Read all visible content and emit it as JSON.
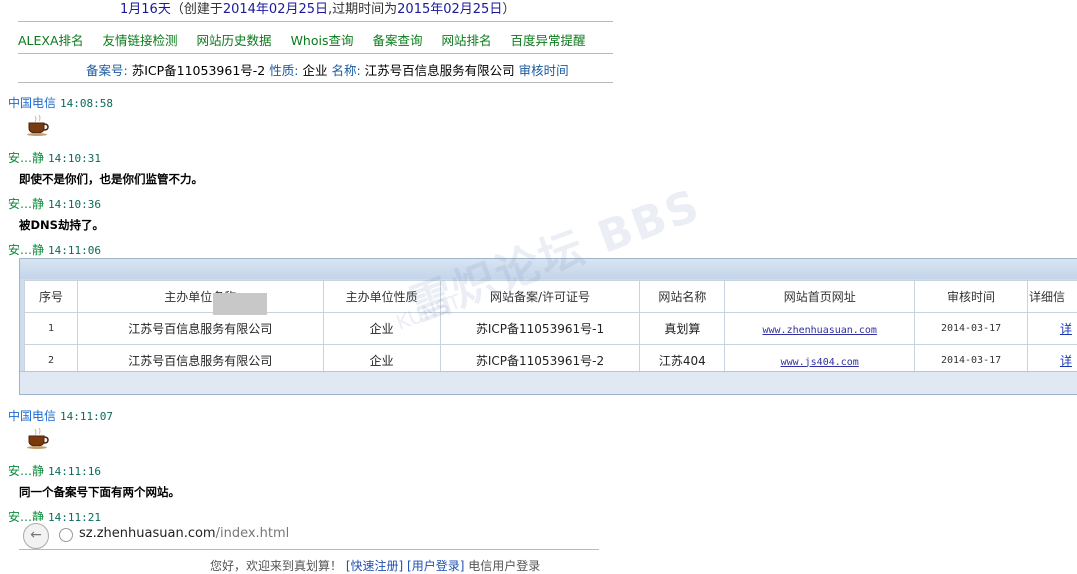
{
  "header": {
    "days_prefix": "1月16天",
    "created_label": "（创建于",
    "created_date": "2014年02月25日",
    "expire_label": ",过期时间为",
    "expire_date": "2015年02月25日",
    "close": "）"
  },
  "nav": [
    "ALEXA排名",
    "友情链接检测",
    "网站历史数据",
    "Whois查询",
    "备案查询",
    "网站排名",
    "百度异常提醒"
  ],
  "registration": {
    "no_label": "备案号:",
    "no_value": "苏ICP备11053961号-2",
    "type_label": "性质:",
    "type_value": "企业",
    "name_label": "名称:",
    "name_value": "江苏号百信息服务有限公司",
    "review_label": "审核时间"
  },
  "messages": [
    {
      "sender": "中国电信",
      "time": "14:08:58",
      "content": ""
    },
    {
      "sender": "安…静",
      "time": "14:10:31",
      "content": "即使不是你们，也是你们监管不力。"
    },
    {
      "sender": "安…静",
      "time": "14:10:36",
      "content": "被DNS劫持了。"
    },
    {
      "sender": "安…静",
      "time": "14:11:06",
      "content": ""
    },
    {
      "sender": "中国电信",
      "time": "14:11:07",
      "content": ""
    },
    {
      "sender": "安…静",
      "time": "14:11:16",
      "content": "同一个备案号下面有两个网站。"
    },
    {
      "sender": "安…静",
      "time": "14:11:21",
      "content": ""
    }
  ],
  "table": {
    "headers": [
      "序号",
      "主办单位名称",
      "主办单位性质",
      "网站备案/许可证号",
      "网站名称",
      "网站首页网址",
      "审核时间",
      "详细信"
    ],
    "rows": [
      [
        "1",
        "江苏号百信息服务有限公司",
        "企业",
        "苏ICP备11053961号-1",
        "真划算",
        "www.zhenhuasuan.com",
        "2014-03-17",
        "详"
      ],
      [
        "2",
        "江苏号百信息服务有限公司",
        "企业",
        "苏ICP备11053961号-2",
        "江苏404",
        "www.js404.com",
        "2014-03-17",
        "详"
      ]
    ]
  },
  "watermark": {
    "main": "雪炽论坛 BBS",
    "sub": "KUNST"
  },
  "browser": {
    "url_host": "sz.zhenhuasuan.com",
    "url_path": "/index.html"
  },
  "bottom": {
    "greeting": "您好，欢迎来到真划算！",
    "register": "[快速注册]",
    "login": "[用户登录]",
    "telecom_login": "电信用户登录"
  }
}
